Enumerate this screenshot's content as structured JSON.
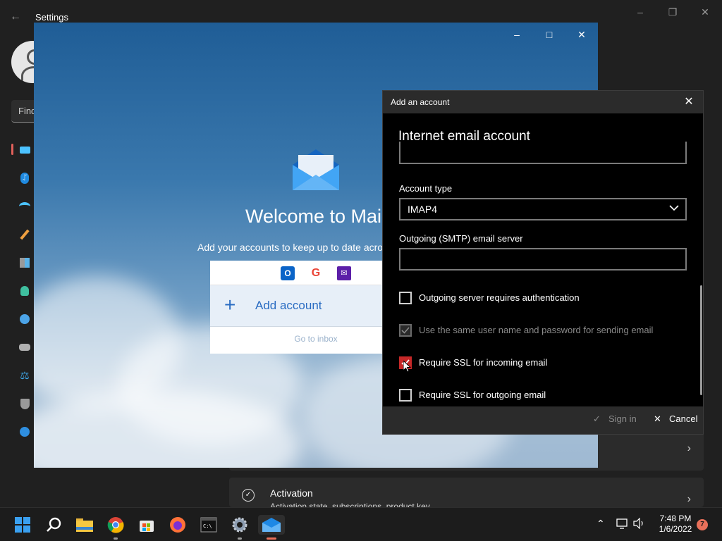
{
  "settings": {
    "title": "Settings",
    "search_placeholder": "Find",
    "nav_icons": [
      "system-icon",
      "bluetooth-icon",
      "network-icon",
      "personalization-icon",
      "apps-icon",
      "accounts-icon",
      "time-language-icon",
      "gaming-icon",
      "accessibility-icon",
      "privacy-security-icon",
      "windows-update-icon"
    ],
    "activation": {
      "title": "Activation",
      "subtitle": "Activation state, subscriptions, product key"
    }
  },
  "mail": {
    "welcome": "Welcome to Mail",
    "subtitle": "Add your accounts to keep up to date across all your devices.",
    "add_account": "Add account",
    "go_to_inbox": "Go to inbox",
    "providers": [
      "outlook-icon",
      "google-icon",
      "yahoo-icon"
    ]
  },
  "dialog": {
    "title": "Add an account",
    "heading": "Internet email account",
    "account_type_label": "Account type",
    "account_type_value": "IMAP4",
    "smtp_label": "Outgoing (SMTP) email server",
    "smtp_value": "",
    "checkboxes": [
      {
        "label": "Outgoing server requires authentication",
        "checked": false,
        "disabled": false
      },
      {
        "label": "Use the same user name and password for sending email",
        "checked": true,
        "disabled": true
      },
      {
        "label": "Require SSL for incoming email",
        "checked": true,
        "disabled": false
      },
      {
        "label": "Require SSL for outgoing email",
        "checked": false,
        "disabled": false
      }
    ],
    "sign_in": "Sign in",
    "cancel": "Cancel"
  },
  "taskbar": {
    "apps": [
      "windows-start-icon",
      "search-icon",
      "file-explorer-icon",
      "chrome-icon",
      "microsoft-store-icon",
      "firefox-icon",
      "terminal-icon",
      "settings-icon",
      "mail-icon"
    ],
    "time": "7:48 PM",
    "date": "1/6/2022",
    "notification_count": "7"
  },
  "colors": {
    "accent": "#2a6cc2",
    "checkbox_red": "#c62828",
    "dialog_bg": "#000000"
  }
}
